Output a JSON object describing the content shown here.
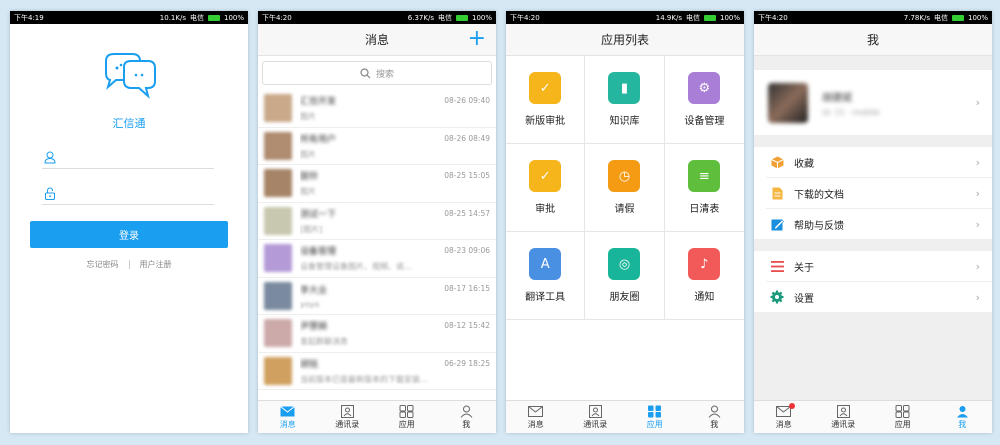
{
  "status_bar": [
    {
      "time": "下午4:19",
      "speed": "10.1K/s",
      "carrier": "电信",
      "battery": "100%"
    },
    {
      "time": "下午4:20",
      "speed": "6.37K/s",
      "carrier": "电信",
      "battery": "100%"
    },
    {
      "time": "下午4:20",
      "speed": "14.9K/s",
      "carrier": "电信",
      "battery": "100%"
    },
    {
      "time": "下午4:20",
      "speed": "7.78K/s",
      "carrier": "电信",
      "battery": "100%"
    }
  ],
  "login": {
    "app_name": "汇信通",
    "login_button": "登录",
    "forgot_password": "忘记密码",
    "register": "用户注册",
    "username_placeholder": "",
    "password_placeholder": ""
  },
  "messages": {
    "title": "消息",
    "search_placeholder": "搜索",
    "items": [
      {
        "name": "汇信开发",
        "preview": "图片",
        "time": "08-26 09:40",
        "color": "#c9a98a"
      },
      {
        "name": "所有用户",
        "preview": "图片",
        "time": "08-26 08:49",
        "color": "#b08c70"
      },
      {
        "name": "鼓铃",
        "preview": "图片",
        "time": "08-25 15:05",
        "color": "#a68467"
      },
      {
        "name": "测试一下",
        "preview": "[图片]",
        "time": "08-25 14:57",
        "color": "#c8c8b0"
      },
      {
        "name": "设备管理",
        "preview": "设备管理设备图片、视频、说...",
        "time": "08-23 09:06",
        "color": "#b49ad6"
      },
      {
        "name": "李大业",
        "preview": "yoyo",
        "time": "08-17 16:15",
        "color": "#7a8aa0"
      },
      {
        "name": "尹慧娟",
        "preview": "发起群聊消息",
        "time": "08-12 15:42",
        "color": "#caa"
      },
      {
        "name": "胡铭",
        "preview": "当前版本已是最新版本的下载安装...",
        "time": "06-29 18:25",
        "color": "#d0a060"
      }
    ]
  },
  "apps": {
    "title": "应用列表",
    "items": [
      {
        "label": "新版审批",
        "icon": "approval-new-icon",
        "color": "#f5b51b",
        "glyph": "✓"
      },
      {
        "label": "知识库",
        "icon": "book-icon",
        "color": "#25b6a0",
        "glyph": "▮"
      },
      {
        "label": "设备管理",
        "icon": "gears-icon",
        "color": "#a97ed6",
        "glyph": "⚙"
      },
      {
        "label": "审批",
        "icon": "approval-icon",
        "color": "#f5b51b",
        "glyph": "✓"
      },
      {
        "label": "请假",
        "icon": "clock-icon",
        "color": "#f59b13",
        "glyph": "◷"
      },
      {
        "label": "日清表",
        "icon": "list-icon",
        "color": "#5fbf3d",
        "glyph": "≡"
      },
      {
        "label": "翻译工具",
        "icon": "translate-icon",
        "color": "#4a90e2",
        "glyph": "A"
      },
      {
        "label": "朋友圈",
        "icon": "aperture-icon",
        "color": "#19b59a",
        "glyph": "◎"
      },
      {
        "label": "通知",
        "icon": "bell-icon",
        "color": "#f25a5a",
        "glyph": "♪"
      }
    ]
  },
  "me": {
    "title": "我",
    "profile_name": "胡建斌",
    "profile_sub": "id: 11 · mobile",
    "rows": [
      {
        "label": "收藏",
        "icon": "box-icon"
      },
      {
        "label": "下载的文档",
        "icon": "document-icon"
      },
      {
        "label": "帮助与反馈",
        "icon": "edit-icon"
      },
      {
        "label": "关于",
        "icon": "menu-icon"
      },
      {
        "label": "设置",
        "icon": "gear-icon"
      }
    ]
  },
  "tabs": {
    "messages": "消息",
    "contacts": "通讯录",
    "apps": "应用",
    "me": "我"
  },
  "colors": {
    "accent": "#1a9ef0",
    "background": "#d5e8f4",
    "badge": "#e33333"
  }
}
